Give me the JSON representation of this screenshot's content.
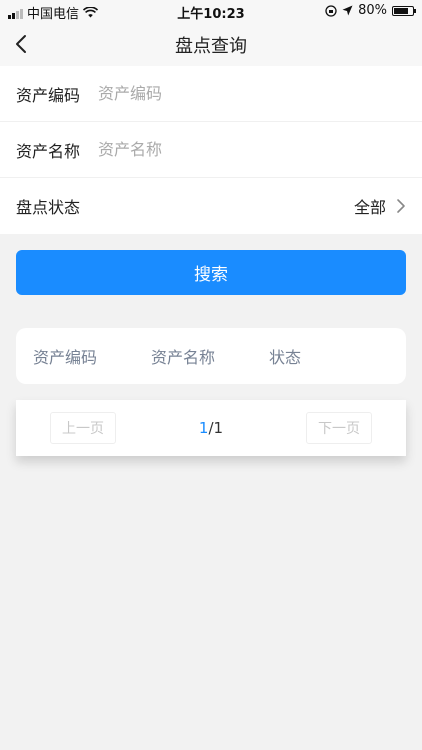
{
  "status_bar": {
    "carrier": "中国电信",
    "time": "上午10:23",
    "battery": "80%",
    "battery_level": 0.8
  },
  "nav": {
    "title": "盘点查询"
  },
  "form": {
    "asset_code_label": "资产编码",
    "asset_code_placeholder": "资产编码",
    "asset_name_label": "资产名称",
    "asset_name_placeholder": "资产名称",
    "status_label": "盘点状态",
    "status_value": "全部"
  },
  "search_label": "搜索",
  "table": {
    "headers": [
      "资产编码",
      "资产名称",
      "状态"
    ]
  },
  "pager": {
    "prev_label": "上一页",
    "current": "1",
    "separator": "/",
    "total": "1",
    "next_label": "下一页"
  },
  "colors": {
    "accent": "#1a8cff",
    "header_text": "#778294"
  }
}
